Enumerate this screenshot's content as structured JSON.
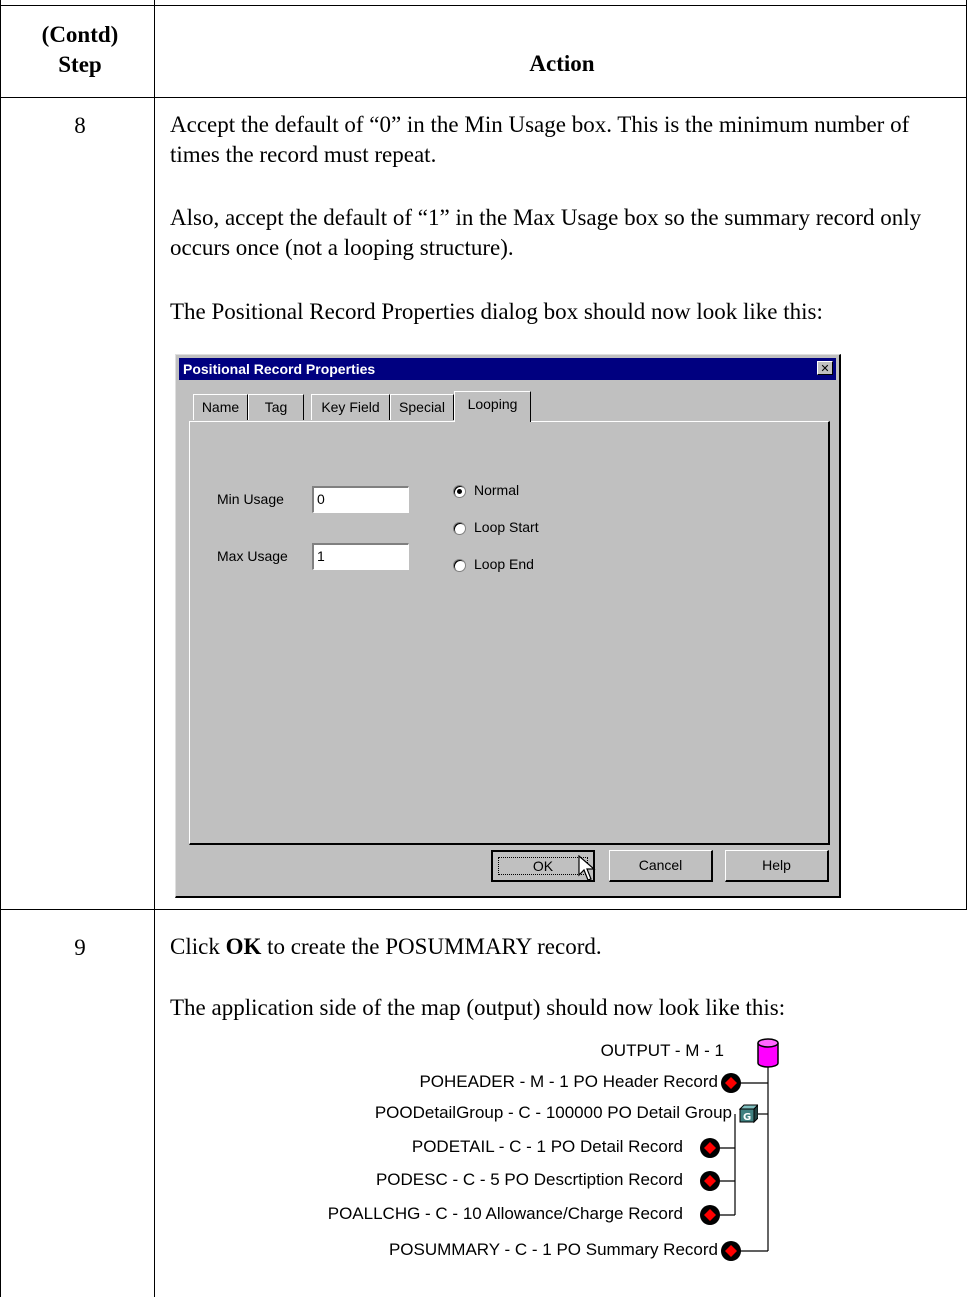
{
  "table": {
    "header": {
      "step_line1": "(Contd)",
      "step_line2": "Step",
      "action": "Action"
    },
    "rows": [
      {
        "step": "8",
        "paragraphs": [
          "Accept the default of “0” in the Min Usage box. This is the minimum number of times the record must repeat.",
          "Also, accept the default of “1” in the Max Usage box so the summary record only occurs once (not a looping structure).",
          "The Positional Record Properties dialog box should now look like this:"
        ]
      },
      {
        "step": "9",
        "p1_before": "Click ",
        "p1_bold": "OK",
        "p1_after": " to create the POSUMMARY record.",
        "p2": "The application side of the map (output) should now look like this:"
      }
    ]
  },
  "dialog": {
    "title": "Positional Record Properties",
    "close_glyph": "✕",
    "tabs": [
      "Name",
      "Tag",
      "Key Field",
      "Special",
      "Looping"
    ],
    "active_tab": "Looping",
    "min_usage_label": "Min Usage",
    "min_usage_value": "0",
    "max_usage_label": "Max Usage",
    "max_usage_value": "1",
    "radio_options": [
      "Normal",
      "Loop Start",
      "Loop End"
    ],
    "selected_option": "Normal",
    "buttons": {
      "ok": "OK",
      "cancel": "Cancel",
      "help": "Help"
    }
  },
  "tree": {
    "icon_colors": {
      "database": "#ff00ff",
      "record": "#ff0000",
      "group": "#408080"
    },
    "nodes": [
      {
        "label": "OUTPUT - M - 1",
        "icon": "database-icon"
      },
      {
        "label": "POHEADER - M - 1 PO Header Record",
        "icon": "record-icon"
      },
      {
        "label": "POODetailGroup - C - 100000 PO Detail Group",
        "icon": "group-icon"
      },
      {
        "label": "PODETAIL - C - 1 PO Detail Record",
        "icon": "record-icon"
      },
      {
        "label": "PODESC - C - 5 PO Descrtiption Record",
        "icon": "record-icon"
      },
      {
        "label": "POALLCHG - C - 10 Allowance/Charge Record",
        "icon": "record-icon"
      },
      {
        "label": "POSUMMARY - C - 1 PO Summary Record",
        "icon": "record-icon"
      }
    ]
  }
}
